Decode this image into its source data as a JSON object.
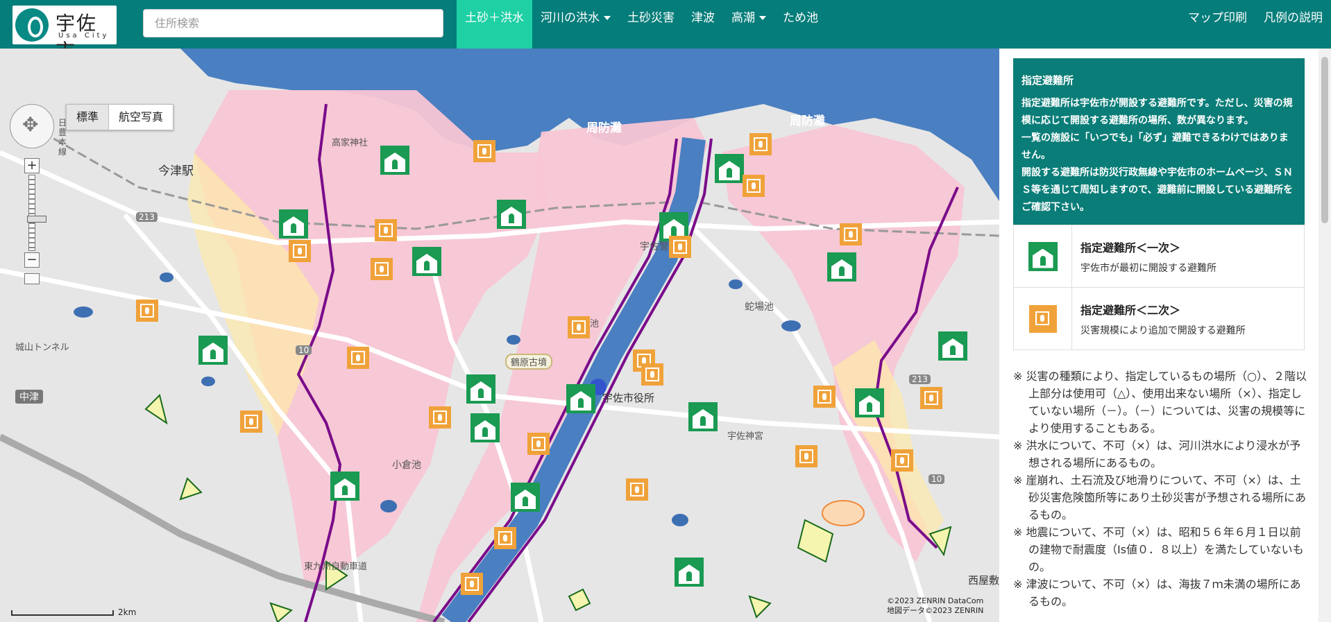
{
  "header": {
    "logo_text": "宇佐市",
    "logo_sub": "Usa City",
    "search_placeholder": "住所検索",
    "nav": [
      {
        "label": "土砂＋洪水",
        "active": true,
        "dropdown": false
      },
      {
        "label": "河川の洪水",
        "active": false,
        "dropdown": true
      },
      {
        "label": "土砂災害",
        "active": false,
        "dropdown": false
      },
      {
        "label": "津波",
        "active": false,
        "dropdown": false
      },
      {
        "label": "高潮",
        "active": false,
        "dropdown": true
      },
      {
        "label": "ため池",
        "active": false,
        "dropdown": false
      }
    ],
    "right_links": [
      "マップ印刷",
      "凡例の説明"
    ]
  },
  "map": {
    "toggle": [
      "標準",
      "航空写真"
    ],
    "toggle_selected": "標準",
    "labels": [
      "周防灘",
      "周防灘",
      "今津駅",
      "高家神社",
      "宇佐警察署",
      "春日池",
      "蛇場池",
      "城山トンネル",
      "中津",
      "鶴原古墳",
      "宇佐市役所",
      "宇佐神宮",
      "小倉池",
      "東九州自動車道",
      "西屋敷",
      "213",
      "10",
      "10",
      "213",
      "日豊本線"
    ],
    "credit_line1": "©2023 ZENRIN DataCom",
    "credit_line2": "地図データ©2023 ZENRIN",
    "scale_label": "2km",
    "colors": {
      "sea": "#4a7fc1",
      "land": "#e6e6e6",
      "flood_pink": "#f8c6d4",
      "flood_yellow": "#fde9a8",
      "river": "#4a7fc1",
      "river_edge": "#7a0c8a",
      "landslide": "#f5f5b0"
    }
  },
  "panel": {
    "info_title": "指定避難所",
    "info_body": [
      "指定避難所は宇佐市が開設する避難所です。ただし、災害の規模に応じて開設する避難所の場所、数が異なります。",
      "一覧の施設に「いつでも」「必ず」避難できるわけではありません。",
      "開設する避難所は防災行政無線や宇佐市のホームページ、ＳＮＳ等を通じて周知しますので、避難前に開設している避難所をご確認下さい。"
    ],
    "legend": [
      {
        "title": "指定避難所＜一次＞",
        "desc": "宇佐市が最初に開設する避難所",
        "icon": "primary-shelter-icon",
        "color": "#1a9a52"
      },
      {
        "title": "指定避難所＜二次＞",
        "desc": "災害規模により追加で開設する避難所",
        "icon": "secondary-shelter-icon",
        "color": "#f0a23a"
      }
    ],
    "notes": [
      "※ 災害の種類により、指定しているもの場所（○）、２階以上部分は使用可（△）、使用出来ない場所（×）、指定していない場所（－）。（－）については、災害の規模等により使用することもある。",
      "※ 洪水について、不可（×）は、河川洪水により浸水が予想される場所にあるもの。",
      "※ 崖崩れ、土石流及び地滑りについて、不可（×）は、土砂災害危険箇所等にあり土砂災害が予想される場所にあるもの。",
      "※ 地震について、不可（×）は、昭和５６年６月１日以前の建物で耐震度（Is値０．８以上）を満たしていないもの。",
      "※ 津波について、不可（×）は、海抜７ｍ未満の場所にあるもの。"
    ]
  }
}
